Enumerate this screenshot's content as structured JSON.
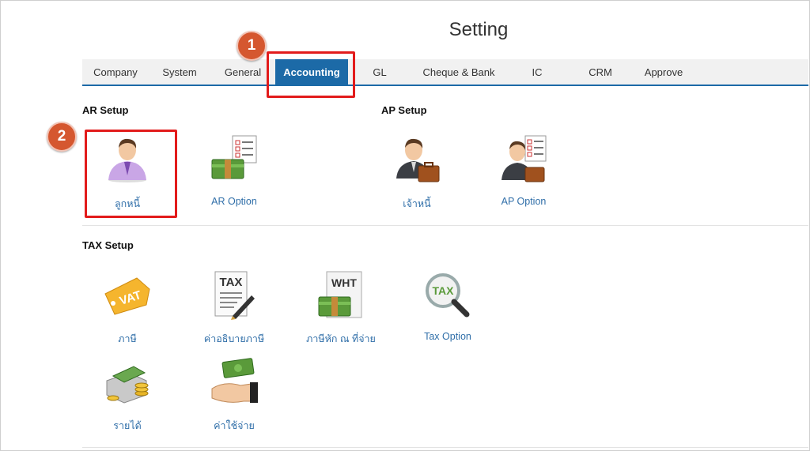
{
  "page": {
    "title": "Setting"
  },
  "tabs": [
    {
      "label": "Company"
    },
    {
      "label": "System"
    },
    {
      "label": "General"
    },
    {
      "label": "Accounting",
      "active": true
    },
    {
      "label": "GL"
    },
    {
      "label": "Cheque & Bank"
    },
    {
      "label": "IC"
    },
    {
      "label": "CRM"
    },
    {
      "label": "Approve"
    }
  ],
  "steps": [
    "1",
    "2"
  ],
  "sections": {
    "ar": {
      "title": "AR Setup",
      "items": [
        {
          "label": "ลูกหนี้",
          "icon": "customer-person-icon"
        },
        {
          "label": "AR Option",
          "icon": "money-checklist-icon"
        }
      ]
    },
    "ap": {
      "title": "AP Setup",
      "items": [
        {
          "label": "เจ้าหนี้",
          "icon": "businessman-briefcase-icon"
        },
        {
          "label": "AP Option",
          "icon": "businessman-checklist-icon"
        }
      ]
    },
    "tax": {
      "title": "TAX Setup",
      "items": [
        {
          "label": "ภาษี",
          "icon": "vat-tag-icon",
          "text": "VAT"
        },
        {
          "label": "ค่าอธิบายภาษี",
          "icon": "tax-document-pen-icon",
          "text": "TAX"
        },
        {
          "label": "ภาษีหัก ณ ที่จ่าย",
          "icon": "wht-document-money-icon",
          "text": "WHT"
        },
        {
          "label": "Tax Option",
          "icon": "tax-magnifier-icon",
          "text": "TAX"
        },
        {
          "label": "รายได้",
          "icon": "income-cash-coins-icon"
        },
        {
          "label": "ค่าใช้จ่าย",
          "icon": "expense-hand-money-icon"
        }
      ]
    }
  },
  "colors": {
    "accent": "#1c6aa7",
    "link": "#2f6ea8",
    "callout": "#e21b1b",
    "step_badge": "#d5572f"
  }
}
